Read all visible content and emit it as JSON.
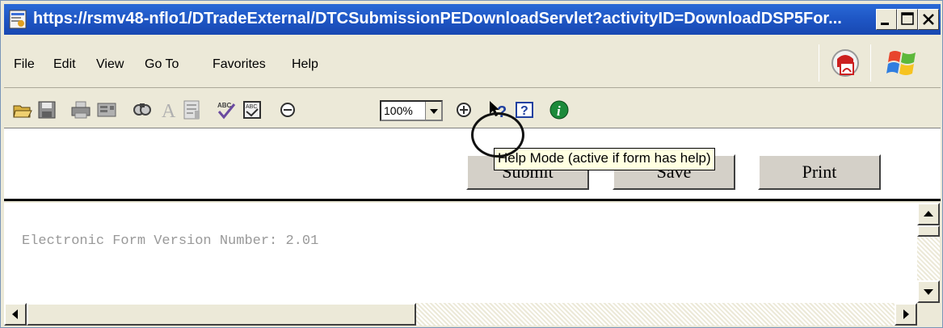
{
  "window": {
    "title": "https://rsmv48-nflo1/DTradeExternal/DTCSubmissionPEDownloadServlet?activityID=DownloadDSP5For...",
    "title_color": "#1f57c6",
    "controls": [
      "minimize-icon",
      "maximize-icon",
      "close-icon"
    ]
  },
  "menu": {
    "items": [
      "File",
      "Edit",
      "View",
      "Go To",
      "Favorites",
      "Help"
    ],
    "logos": [
      "pdf-logo-icon",
      "windows-flag-icon"
    ]
  },
  "toolbar": {
    "icons": [
      "open-icon",
      "save-icon",
      "print-icon",
      "email-icon",
      "find-icon",
      "text-icon",
      "page-icon",
      "spellcheck-icon",
      "form-icon",
      "zoom-out-icon",
      "zoom-in-icon",
      "help-mode-icon",
      "help-icon",
      "info-icon"
    ],
    "zoom_value": "100%",
    "tooltip": "Help Mode (active if form has help)"
  },
  "form": {
    "buttons": [
      "Submit",
      "Save",
      "Print"
    ],
    "version_label": "Electronic Form Version Number:",
    "version_value": "2.01"
  }
}
